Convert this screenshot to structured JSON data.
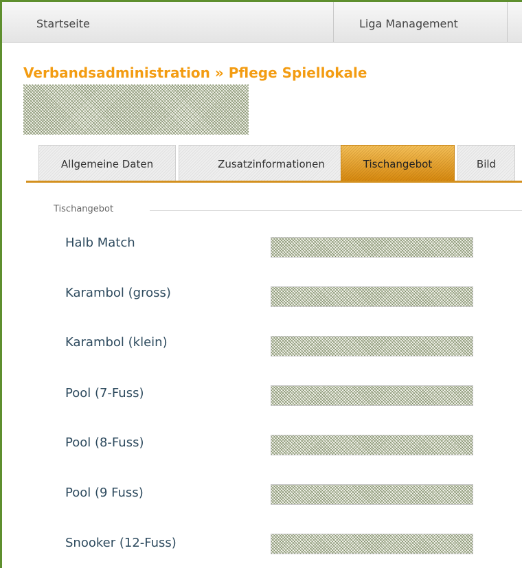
{
  "topnav": {
    "items": [
      {
        "label": "Startseite"
      },
      {
        "label": "Liga Management"
      }
    ]
  },
  "page": {
    "title": "Verbandsadministration » Pflege Spiellokale"
  },
  "tabs": [
    {
      "label": "Allgemeine Daten",
      "active": false
    },
    {
      "label": "Zusatzinformationen",
      "active": false
    },
    {
      "label": "Tischangebot",
      "active": true
    },
    {
      "label": "Bild",
      "active": false
    }
  ],
  "fieldset": {
    "legend": "Tischangebot",
    "rows": [
      {
        "label": "Halb Match"
      },
      {
        "label": "Karambol (gross)"
      },
      {
        "label": "Karambol (klein)"
      },
      {
        "label": "Pool (7-Fuss)"
      },
      {
        "label": "Pool (8-Fuss)"
      },
      {
        "label": "Pool (9 Fuss)"
      },
      {
        "label": "Snooker (12-Fuss)"
      }
    ]
  },
  "colors": {
    "title": "#f39c12",
    "tab_active": "#e9a22c",
    "frame": "#5e8f2e",
    "label": "#2d4a5e"
  }
}
